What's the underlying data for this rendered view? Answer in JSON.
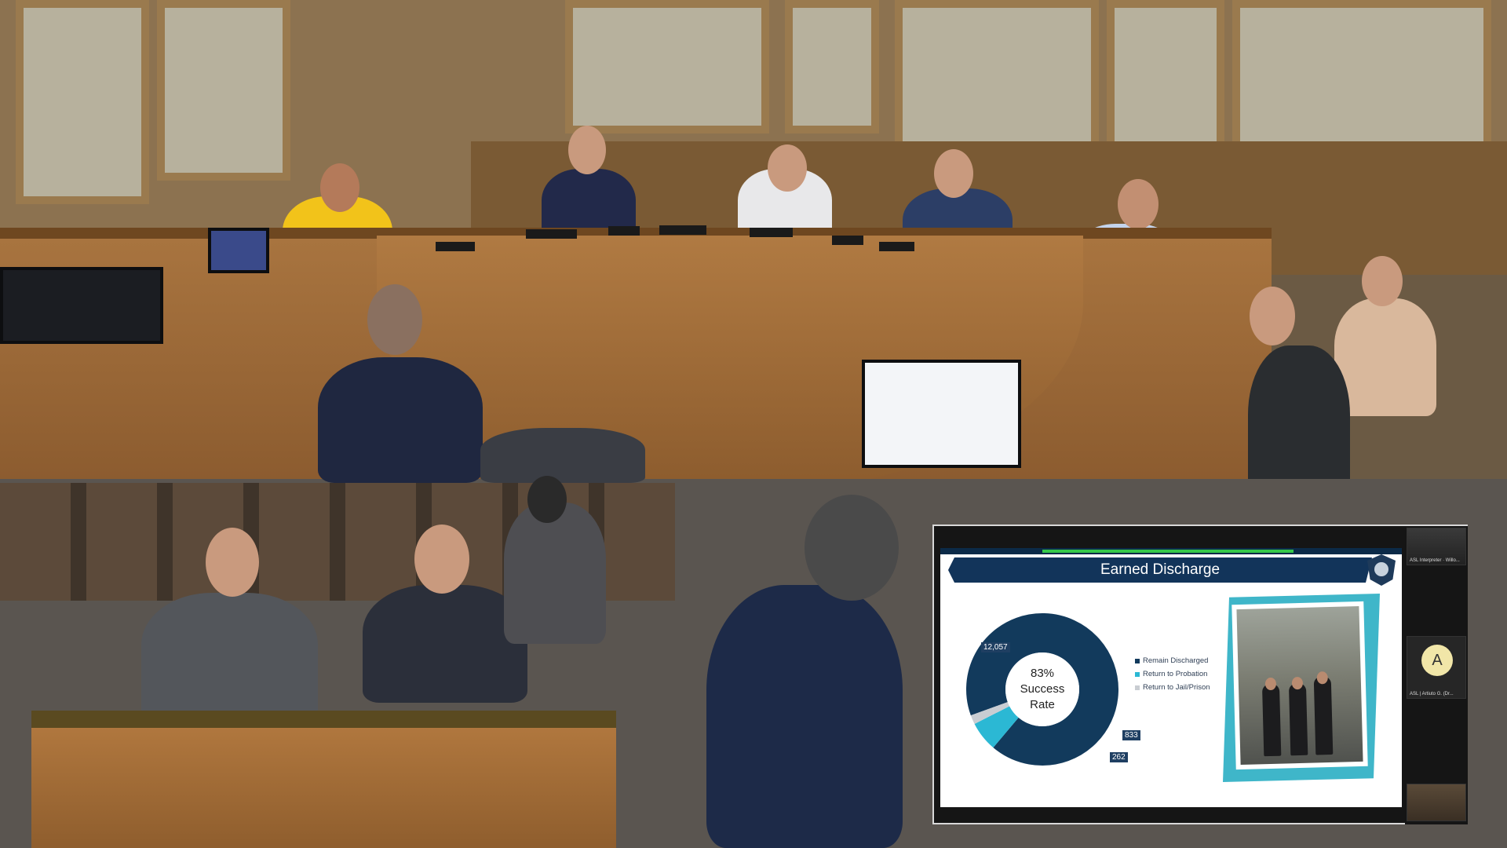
{
  "slide": {
    "title": "Earned Discharge",
    "center_percent": "83%",
    "center_line1": "Success",
    "center_line2": "Rate",
    "labels": {
      "remain": "12,057",
      "probation": "833",
      "jail": "262"
    }
  },
  "chart_data": {
    "type": "pie",
    "title": "Earned Discharge",
    "categories": [
      "Remain Discharged",
      "Return to Probation",
      "Return to Jail/Prison"
    ],
    "values": [
      12057,
      833,
      262
    ],
    "colors": [
      "#123a5c",
      "#2bb8d4",
      "#c9cdd2"
    ],
    "legend": "right"
  },
  "legend": [
    {
      "label": "Remain Discharged",
      "color": "#123a5c"
    },
    {
      "label": "Return to Probation",
      "color": "#2bb8d4"
    },
    {
      "label": "Return to Jail/Prison",
      "color": "#c9cdd2"
    }
  ],
  "participants": {
    "p1": "ASL Interpreter · Willo... ",
    "p2": "ASL | Artiuto G. (Dr... ",
    "avatar_letter": "A"
  }
}
